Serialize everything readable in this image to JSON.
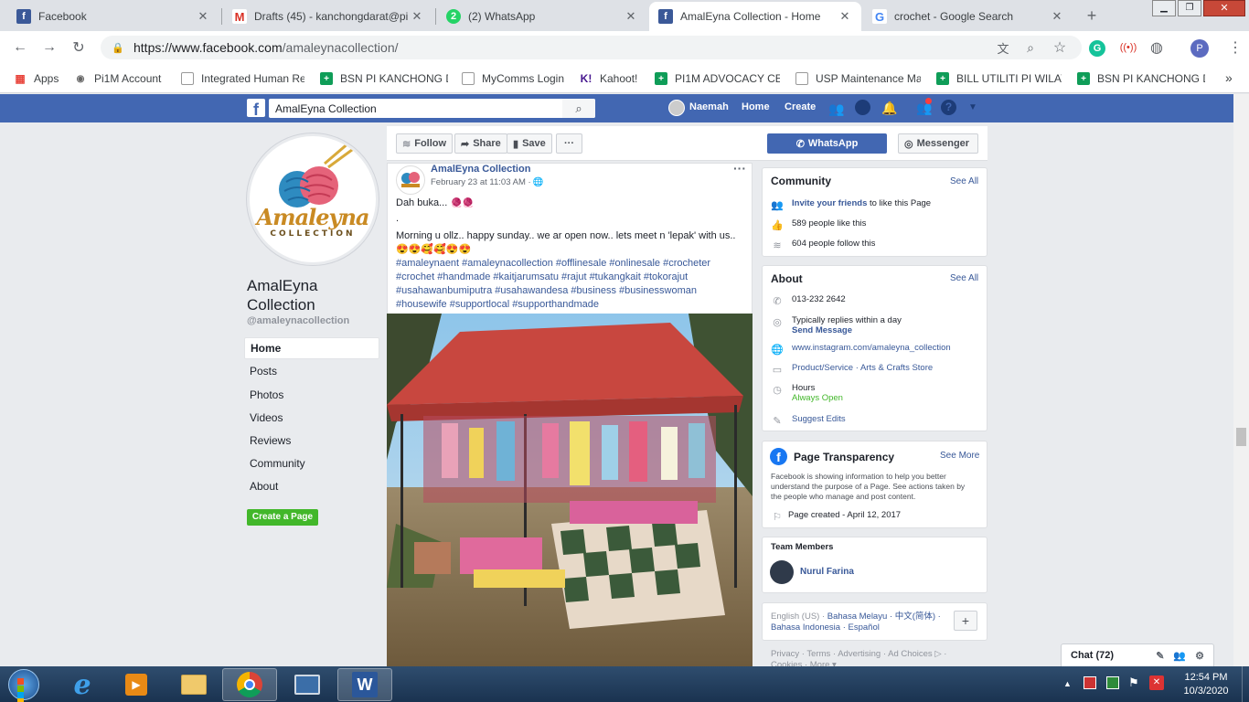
{
  "browser": {
    "tabs": [
      {
        "title": "Facebook",
        "icon": "facebook-icon"
      },
      {
        "title": "Drafts (45) - kanchongdarat@pi",
        "icon": "gmail-icon"
      },
      {
        "title": "(2) WhatsApp",
        "icon": "whatsapp-icon"
      },
      {
        "title": "AmalEyna Collection - Home",
        "icon": "facebook-icon"
      },
      {
        "title": "crochet - Google Search",
        "icon": "google-icon"
      }
    ],
    "new_tab": "+",
    "url_domain": "https://www.facebook.com",
    "url_path": "/amaleynacollection/",
    "profile_initial": "P",
    "bookmarks": [
      {
        "label": "Apps",
        "icon": "apps-grid-icon"
      },
      {
        "label": "Pi1M Account",
        "icon": "server-icon"
      },
      {
        "label": "Integrated Human Re",
        "icon": "page-icon"
      },
      {
        "label": "BSN PI KANCHONG D",
        "icon": "sheets-icon"
      },
      {
        "label": "MyComms Login",
        "icon": "page-icon"
      },
      {
        "label": "Kahoot!",
        "icon": "kahoot-icon"
      },
      {
        "label": "PI1M ADVOCACY CEN",
        "icon": "sheets-icon"
      },
      {
        "label": "USP Maintenance Ma",
        "icon": "page-icon"
      },
      {
        "label": "BILL UTILITI PI WILAY",
        "icon": "sheets-icon"
      },
      {
        "label": "BSN PI KANCHONG D",
        "icon": "sheets-icon"
      }
    ],
    "bookmarks_more": "»"
  },
  "fb": {
    "search_value": "AmalEyna Collection",
    "user_name": "Naemah",
    "nav_home": "Home",
    "nav_create": "Create"
  },
  "page": {
    "name_line1": "AmalEyna",
    "name_line2": "Collection",
    "handle": "@amaleynacollection",
    "logo_text_1": "Amaleyna",
    "logo_text_2": "COLLECTION",
    "left_nav": [
      "Home",
      "Posts",
      "Photos",
      "Videos",
      "Reviews",
      "Community",
      "About"
    ],
    "create_page": "Create a Page",
    "actions": {
      "follow": "Follow",
      "share": "Share",
      "save": "Save",
      "more": "···",
      "whatsapp": "WhatsApp",
      "messenger": "Messenger"
    }
  },
  "post": {
    "author": "AmalEyna Collection",
    "time": "February 23 at 11:03 AM · ",
    "line1": "Dah buka...",
    "line2": ".",
    "line3": "Morning u ollz.. happy sunday.. we ar open now.. lets meet n 'lepak' with us..",
    "emojis": "😍😍🥰🥰😍😍",
    "hashtags_1": "#amaleynaent #amaleynacollection #offlinesale #onlinesale #crocheter",
    "hashtags_2": "#crochet #handmade #kaitjarumsatu #rajut #tukangkait #tokorajut",
    "hashtags_3": "#usahawanbumiputra #usahawandesa #business #businesswoman",
    "hashtags_4": "#housewife #supportlocal #supporthandmade",
    "options": "···"
  },
  "community": {
    "title": "Community",
    "see_all": "See All",
    "invite_link": "Invite your friends",
    "invite_rest": " to like this Page",
    "likes": "589 people like this",
    "follows": "604 people follow this"
  },
  "about": {
    "title": "About",
    "see_all": "See All",
    "phone": "013-232 2642",
    "replies": "Typically replies within a day",
    "send_message": "Send Message",
    "instagram": "www.instagram.com/amaleyna_collection",
    "category": "Product/Service · Arts & Crafts Store",
    "hours_label": "Hours",
    "hours_value": "Always Open",
    "suggest": "Suggest Edits"
  },
  "transparency": {
    "title": "Page Transparency",
    "see_more": "See More",
    "desc_1": "Facebook is showing information to help you better",
    "desc_2": "understand the purpose of a Page. See actions taken by",
    "desc_3": "the people who manage and post content.",
    "created": "Page created - April 12, 2017"
  },
  "team": {
    "title": "Team Members",
    "member": "Nurul Farina"
  },
  "languages": {
    "line1_a": "English (US) · ",
    "line1_b": "Bahasa Melayu · 中文(简体) ·",
    "line2": "Bahasa Indonesia · Español",
    "add": "+"
  },
  "footer": {
    "links": "Privacy · Terms · Advertising · Ad Choices ▷ ·",
    "links2": "Cookies · More ▾"
  },
  "chat": {
    "label": "Chat (72)"
  },
  "taskbar": {
    "time": "12:54 PM",
    "date": "10/3/2020"
  },
  "colors": {
    "fb_blue": "#4267b2",
    "link": "#385898",
    "green": "#42b72a"
  }
}
